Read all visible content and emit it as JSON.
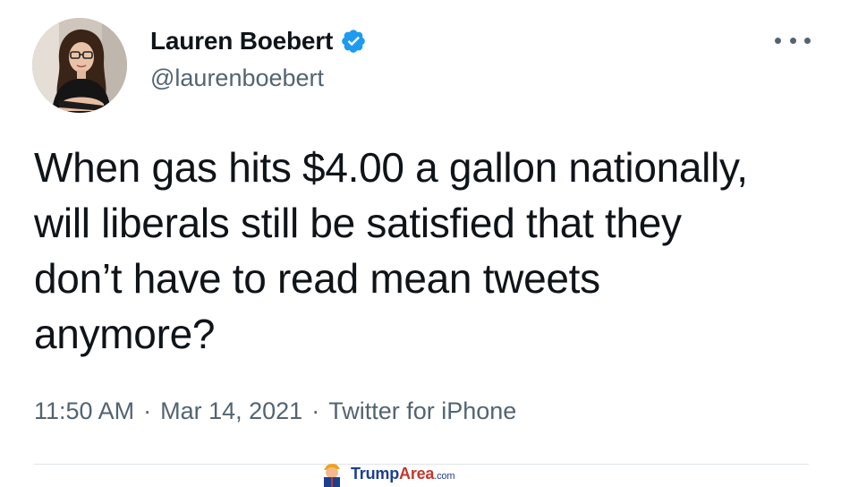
{
  "author": {
    "display_name": "Lauren Boebert",
    "handle": "@laurenboebert",
    "verified": true,
    "avatar_icon": "profile-photo"
  },
  "tweet": {
    "text": "When gas hits $4.00 a gallon nationally,\nwill liberals still be satisfied that they\ndon’t have to read mean tweets\nanymore?",
    "time": "11:50 AM",
    "date": "Mar 14, 2021",
    "source": "Twitter for iPhone",
    "separator": "·"
  },
  "watermark": {
    "part1": "Trump",
    "part2": "Area",
    "part3": ".com"
  },
  "colors": {
    "verified_badge": "#1d9bf0",
    "text_primary": "#0f1419",
    "text_secondary": "#536471"
  }
}
